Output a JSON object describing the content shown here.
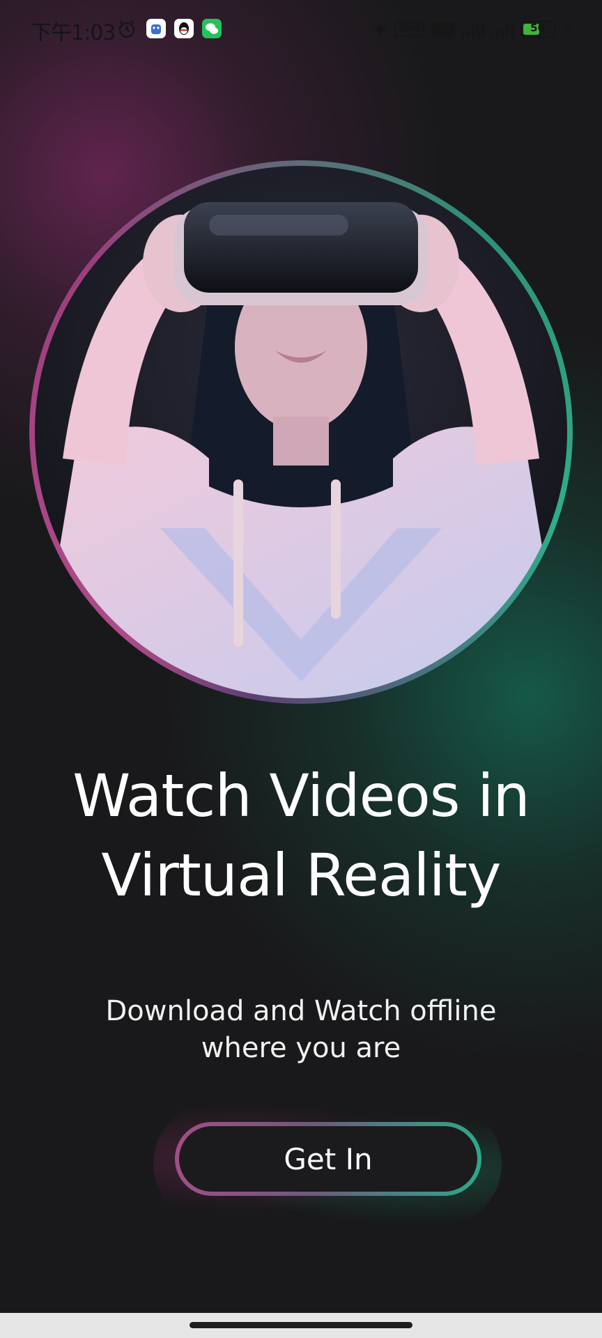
{
  "status_bar": {
    "time": "下午1:03",
    "icons": [
      "alarm-icon",
      "app-icon-blue",
      "qq-icon",
      "wechat-icon",
      "dot-icon",
      "bluetooth-icon",
      "vpn-icon",
      "hd-icon",
      "signal-4g-icon",
      "signal-5g-icon",
      "battery-icon",
      "charging-icon"
    ],
    "vpn_label": "VPN",
    "hd_label": "HD",
    "network_1": "4G",
    "network_2": "5G",
    "battery_level": "56",
    "battery_fraction": 0.56
  },
  "hero": {
    "image": "woman-wearing-vr-headset",
    "ring_colors": [
      "#b04a8b",
      "#2fae8b"
    ]
  },
  "content": {
    "headline_line1": "Watch Videos in",
    "headline_line2": "Virtual Reality",
    "subline_line1": "Download and Watch offline",
    "subline_line2": "where you are"
  },
  "cta": {
    "label": "Get In",
    "gradient": [
      "#a04f86",
      "#2ea88a"
    ]
  },
  "colors": {
    "background": "#19191b",
    "accent_pink": "#b04a8b",
    "accent_green": "#2fae8b",
    "text": "#ffffff"
  }
}
